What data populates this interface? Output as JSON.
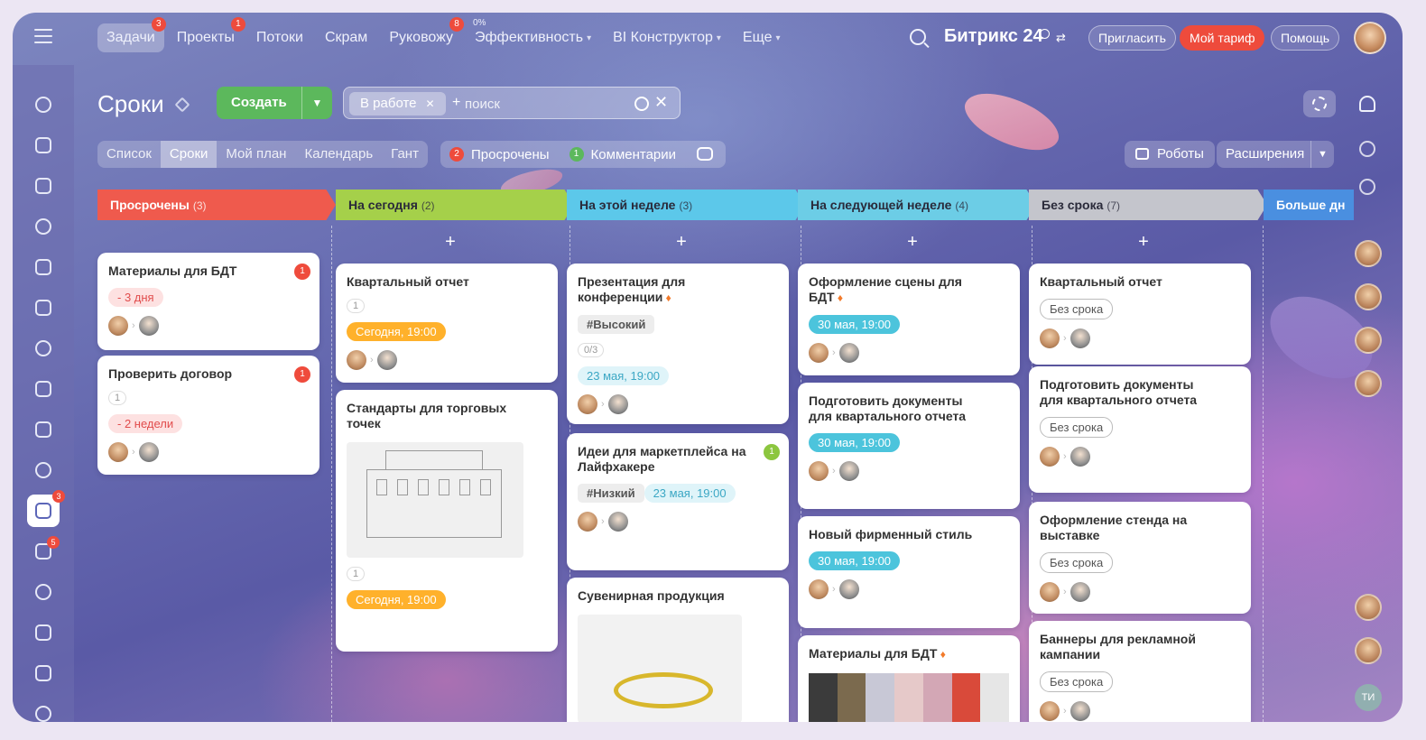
{
  "nav": {
    "items": [
      {
        "label": "Задачи",
        "badge": "3",
        "active": true
      },
      {
        "label": "Проекты",
        "badge": "1"
      },
      {
        "label": "Потоки"
      },
      {
        "label": "Скрам"
      },
      {
        "label": "Руковожу",
        "badge": "8"
      },
      {
        "label": "Эффективность",
        "sup": "0%",
        "chevron": true
      },
      {
        "label": "BI Конструктор",
        "chevron": true
      },
      {
        "label": "Еще",
        "chevron": true
      }
    ],
    "brand": "Битрикс 24",
    "invite": "Пригласить",
    "tariff": "Мой тариф",
    "help": "Помощь"
  },
  "sidebar": {
    "icons": [
      "flow-icon",
      "chat-icon",
      "feed-icon",
      "target-icon",
      "calendar-icon",
      "document-icon",
      "presentation-icon",
      "drive-icon",
      "mail-icon",
      "contacts-icon",
      "tasks-icon",
      "filter-icon",
      "planner-icon",
      "store-icon",
      "goal-icon",
      "cart-icon"
    ],
    "tasks_badge": "3",
    "filter_badge": "5"
  },
  "header": {
    "title": "Сроки",
    "create_label": "Создать",
    "filter_chip": "В работе",
    "search_placeholder": "поиск"
  },
  "views": {
    "tabs": [
      "Список",
      "Сроки",
      "Мой план",
      "Календарь",
      "Гант"
    ],
    "active": 1,
    "overdue_count": "2",
    "overdue_label": "Просрочены",
    "comments_count": "1",
    "comments_label": "Комментарии",
    "robots_label": "Роботы",
    "extensions_label": "Расширения"
  },
  "columns": [
    {
      "title": "Просрочены",
      "count": "(3)",
      "color": "#ef5a4d",
      "light_text": true,
      "add": false,
      "cards": [
        {
          "title": "Материалы для БДТ",
          "badge": "1",
          "badge_color": "#ef4b3c",
          "tag": "- 3 дня",
          "tag_style": "red"
        },
        {
          "title": "Проверить договор",
          "badge": "1",
          "badge_color": "#ef4b3c",
          "meta": "1",
          "tag": "- 2 недели",
          "tag_style": "red"
        }
      ]
    },
    {
      "title": "На сегодня",
      "count": "(2)",
      "color": "#a5d04a",
      "add": true,
      "cards": [
        {
          "title": "Квартальный отчет",
          "meta": "1",
          "tag": "Сегодня, 19:00",
          "tag_style": "orange"
        },
        {
          "title": "Стандарты для торговых точек",
          "image": "building",
          "meta": "1",
          "tag": "Сегодня, 19:00",
          "tag_style": "orange"
        }
      ]
    },
    {
      "title": "На этой неделе",
      "count": "(3)",
      "color": "#5cc8ea",
      "add": true,
      "cards": [
        {
          "title": "Презентация для конференции",
          "fire": true,
          "hashtag": "#Высокий",
          "meta": "0/3",
          "tag": "23 мая, 19:00",
          "tag_style": "teal-l"
        },
        {
          "title": "Идеи для маркетплейса на Лайфхакере",
          "badge": "1",
          "badge_color": "#8cc63f",
          "hashtag": "#Низкий",
          "tag": "23 мая, 19:00",
          "tag_style": "teal-l"
        },
        {
          "title": "Сувенирная продукция",
          "image": "items"
        }
      ]
    },
    {
      "title": "На следующей неделе",
      "count": "(4)",
      "color": "#6ccde6",
      "add": true,
      "cards": [
        {
          "title": "Оформление сцены для БДТ",
          "fire": true,
          "tag": "30 мая, 19:00",
          "tag_style": "teal"
        },
        {
          "title": "Подготовить документы для квартального отчета",
          "tag": "30 мая, 19:00",
          "tag_style": "teal"
        },
        {
          "title": "Новый фирменный стиль",
          "tag": "30 мая, 19:00",
          "tag_style": "teal"
        },
        {
          "title": "Материалы для БДТ",
          "fire": true,
          "image": "fabric"
        }
      ]
    },
    {
      "title": "Без срока",
      "count": "(7)",
      "color": "#c4c5cc",
      "add": true,
      "cards": [
        {
          "title": "Квартальный отчет",
          "tag": "Без срока",
          "tag_style": "grey"
        },
        {
          "title": "Подготовить документы для квартального отчета",
          "tag": "Без срока",
          "tag_style": "grey"
        },
        {
          "title": "Оформление стенда на выставке",
          "tag": "Без срока",
          "tag_style": "grey"
        },
        {
          "title": "Баннеры для рекламной кампании",
          "tag": "Без срока",
          "tag_style": "grey"
        }
      ]
    },
    {
      "title": "Больше дн",
      "color": "#4a8fe0",
      "light_text": true,
      "add": false,
      "cards": []
    }
  ],
  "rightbar": {
    "initials": "ТИ"
  },
  "colors": {
    "accent_green": "#5cb85c",
    "alert_red": "#ee4b3c",
    "deadline_orange": "#ffb12b",
    "deadline_teal": "#4cc4dc"
  }
}
